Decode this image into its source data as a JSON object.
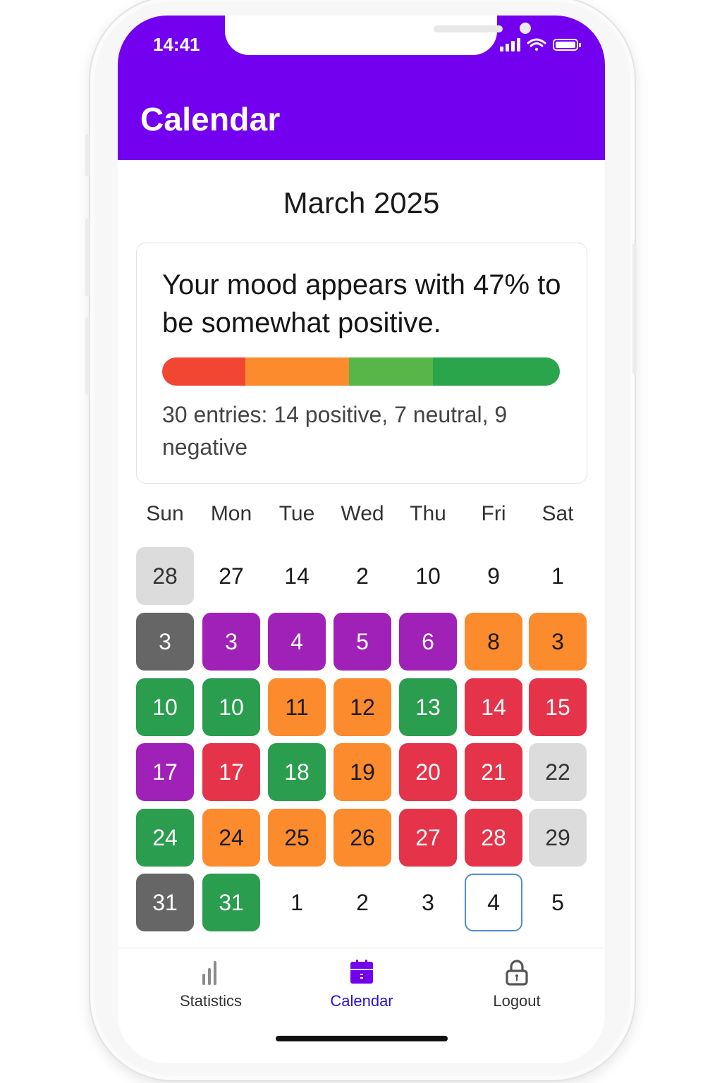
{
  "status_bar": {
    "time": "14:41"
  },
  "header": {
    "title": "Calendar"
  },
  "month_title": "March 2025",
  "summary": {
    "text": "Your mood appears with 47% to be somewhat positive.",
    "detail": "30 entries: 14 positive, 7 neutral, 9 negative",
    "mood_bar": [
      {
        "label": "negative",
        "fraction": 0.21,
        "color": "#f14632"
      },
      {
        "label": "somewhat negative",
        "fraction": 0.26,
        "color": "#fb8b2d"
      },
      {
        "label": "somewhat positive",
        "fraction": 0.21,
        "color": "#58b547"
      },
      {
        "label": "positive",
        "fraction": 0.32,
        "color": "#2aa54c"
      }
    ]
  },
  "weekdays": [
    "Sun",
    "Mon",
    "Tue",
    "Wed",
    "Thu",
    "Fri",
    "Sat"
  ],
  "colors": {
    "accent": "#7300ee",
    "gray": "#dcdcdc",
    "dark": "#666666",
    "purple": "#a021b8",
    "orange": "#fb8b2d",
    "green": "#2a9d4e",
    "red": "#e5334a",
    "selected_outline": "#4e90cc"
  },
  "calendar_rows": [
    [
      {
        "day": "28",
        "mood": "gray"
      },
      {
        "day": "27",
        "mood": "none"
      },
      {
        "day": "14",
        "mood": "none"
      },
      {
        "day": "2",
        "mood": "none"
      },
      {
        "day": "10",
        "mood": "none"
      },
      {
        "day": "9",
        "mood": "none"
      },
      {
        "day": "1",
        "mood": "none"
      }
    ],
    [
      {
        "day": "3",
        "mood": "dark"
      },
      {
        "day": "3",
        "mood": "purple"
      },
      {
        "day": "4",
        "mood": "purple"
      },
      {
        "day": "5",
        "mood": "purple"
      },
      {
        "day": "6",
        "mood": "purple"
      },
      {
        "day": "8",
        "mood": "orange"
      },
      {
        "day": "3",
        "mood": "orange"
      }
    ],
    [
      {
        "day": "10",
        "mood": "green"
      },
      {
        "day": "10",
        "mood": "green"
      },
      {
        "day": "11",
        "mood": "orange"
      },
      {
        "day": "12",
        "mood": "orange"
      },
      {
        "day": "13",
        "mood": "green"
      },
      {
        "day": "14",
        "mood": "red"
      },
      {
        "day": "15",
        "mood": "red"
      }
    ],
    [
      {
        "day": "17",
        "mood": "purple"
      },
      {
        "day": "17",
        "mood": "red"
      },
      {
        "day": "18",
        "mood": "green"
      },
      {
        "day": "19",
        "mood": "orange"
      },
      {
        "day": "20",
        "mood": "red"
      },
      {
        "day": "21",
        "mood": "red"
      },
      {
        "day": "22",
        "mood": "gray"
      }
    ],
    [
      {
        "day": "24",
        "mood": "green"
      },
      {
        "day": "24",
        "mood": "orange"
      },
      {
        "day": "25",
        "mood": "orange"
      },
      {
        "day": "26",
        "mood": "orange"
      },
      {
        "day": "27",
        "mood": "red"
      },
      {
        "day": "28",
        "mood": "red"
      },
      {
        "day": "29",
        "mood": "gray"
      }
    ],
    [
      {
        "day": "31",
        "mood": "dark"
      },
      {
        "day": "31",
        "mood": "green"
      },
      {
        "day": "1",
        "mood": "none"
      },
      {
        "day": "2",
        "mood": "none"
      },
      {
        "day": "3",
        "mood": "none"
      },
      {
        "day": "4",
        "mood": "selected"
      },
      {
        "day": "5",
        "mood": "none"
      }
    ]
  ],
  "tab_bar": {
    "items": [
      {
        "label": "Statistics",
        "icon": "bar-chart-icon",
        "active": false
      },
      {
        "label": "Calendar",
        "icon": "calendar-icon",
        "active": true
      },
      {
        "label": "Logout",
        "icon": "lock-icon",
        "active": false
      }
    ]
  }
}
